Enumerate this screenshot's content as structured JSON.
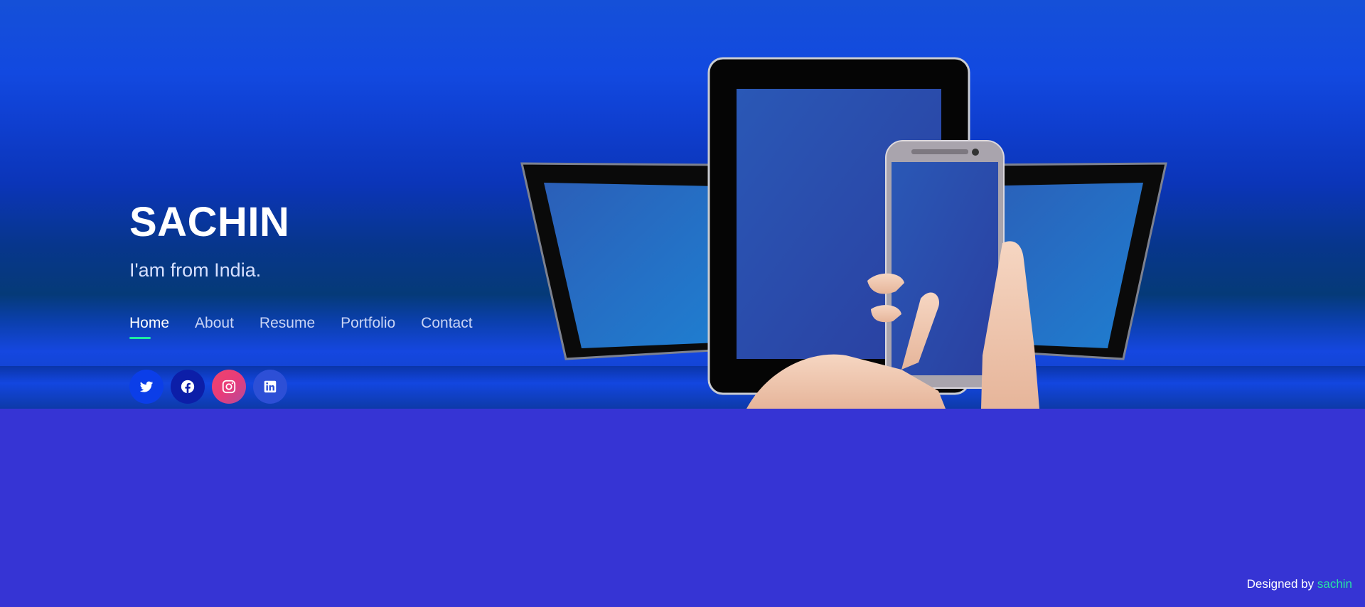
{
  "hero": {
    "name": "SACHIN",
    "tagline": "I'am from India."
  },
  "nav": [
    {
      "label": "Home",
      "active": true
    },
    {
      "label": "About",
      "active": false
    },
    {
      "label": "Resume",
      "active": false
    },
    {
      "label": "Portfolio",
      "active": false
    },
    {
      "label": "Contact",
      "active": false
    }
  ],
  "social": [
    {
      "icon": "twitter-icon",
      "color": "#0b3ee8"
    },
    {
      "icon": "facebook-icon",
      "color": "#0c1ea8"
    },
    {
      "icon": "instagram-icon",
      "color": "#e83b7a"
    },
    {
      "icon": "linkedin-icon",
      "color": "#2d4fd6"
    }
  ],
  "footer": {
    "prefix": "Designed by",
    "author": "sachin"
  },
  "colors": {
    "page_background": "#3634d4",
    "accent": "#1de9a0",
    "footer_link": "#27e3a4"
  }
}
